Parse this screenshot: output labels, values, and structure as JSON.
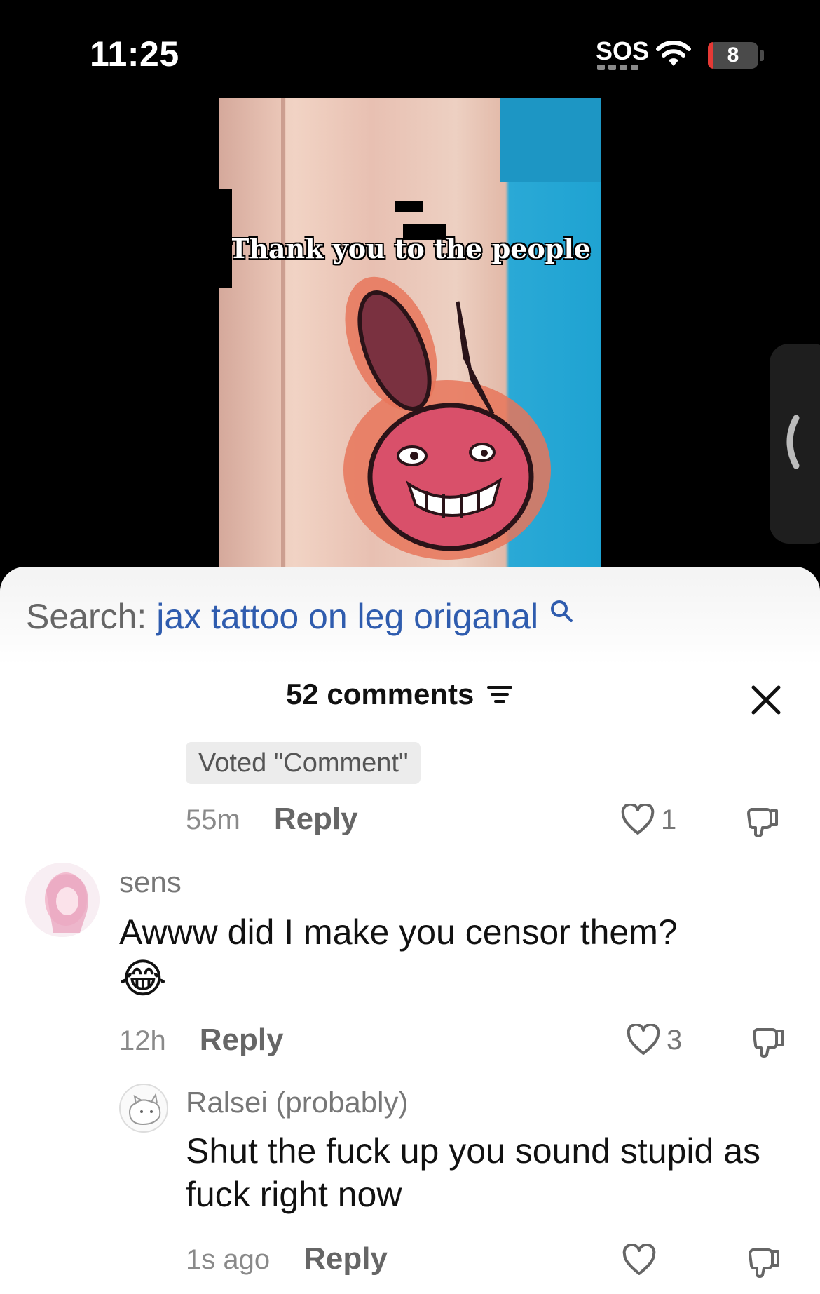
{
  "status_bar": {
    "time": "11:25",
    "sos": "SOS",
    "battery_level": "8",
    "icons": [
      "wifi-icon",
      "battery-icon"
    ]
  },
  "video": {
    "caption": "Thank you to the people"
  },
  "search": {
    "prefix": "Search:",
    "query": "jax tattoo on leg origanal"
  },
  "comments_header": {
    "count_label": "52 comments"
  },
  "comments": [
    {
      "voted_badge": "Voted \"Comment\"",
      "time": "55m",
      "reply_label": "Reply",
      "likes": "1"
    },
    {
      "username": "sens",
      "text": "Awww did I make you censor them?",
      "emoji": "😂",
      "time": "12h",
      "reply_label": "Reply",
      "likes": "3"
    },
    {
      "username": "Ralsei (probably)",
      "text": "Shut the fuck up you sound stupid as fuck right now",
      "time": "1s ago",
      "reply_label": "Reply",
      "likes": ""
    }
  ],
  "colors": {
    "search_query": "#2f5cae",
    "background_top": "#000000",
    "sheet": "#ffffff"
  }
}
